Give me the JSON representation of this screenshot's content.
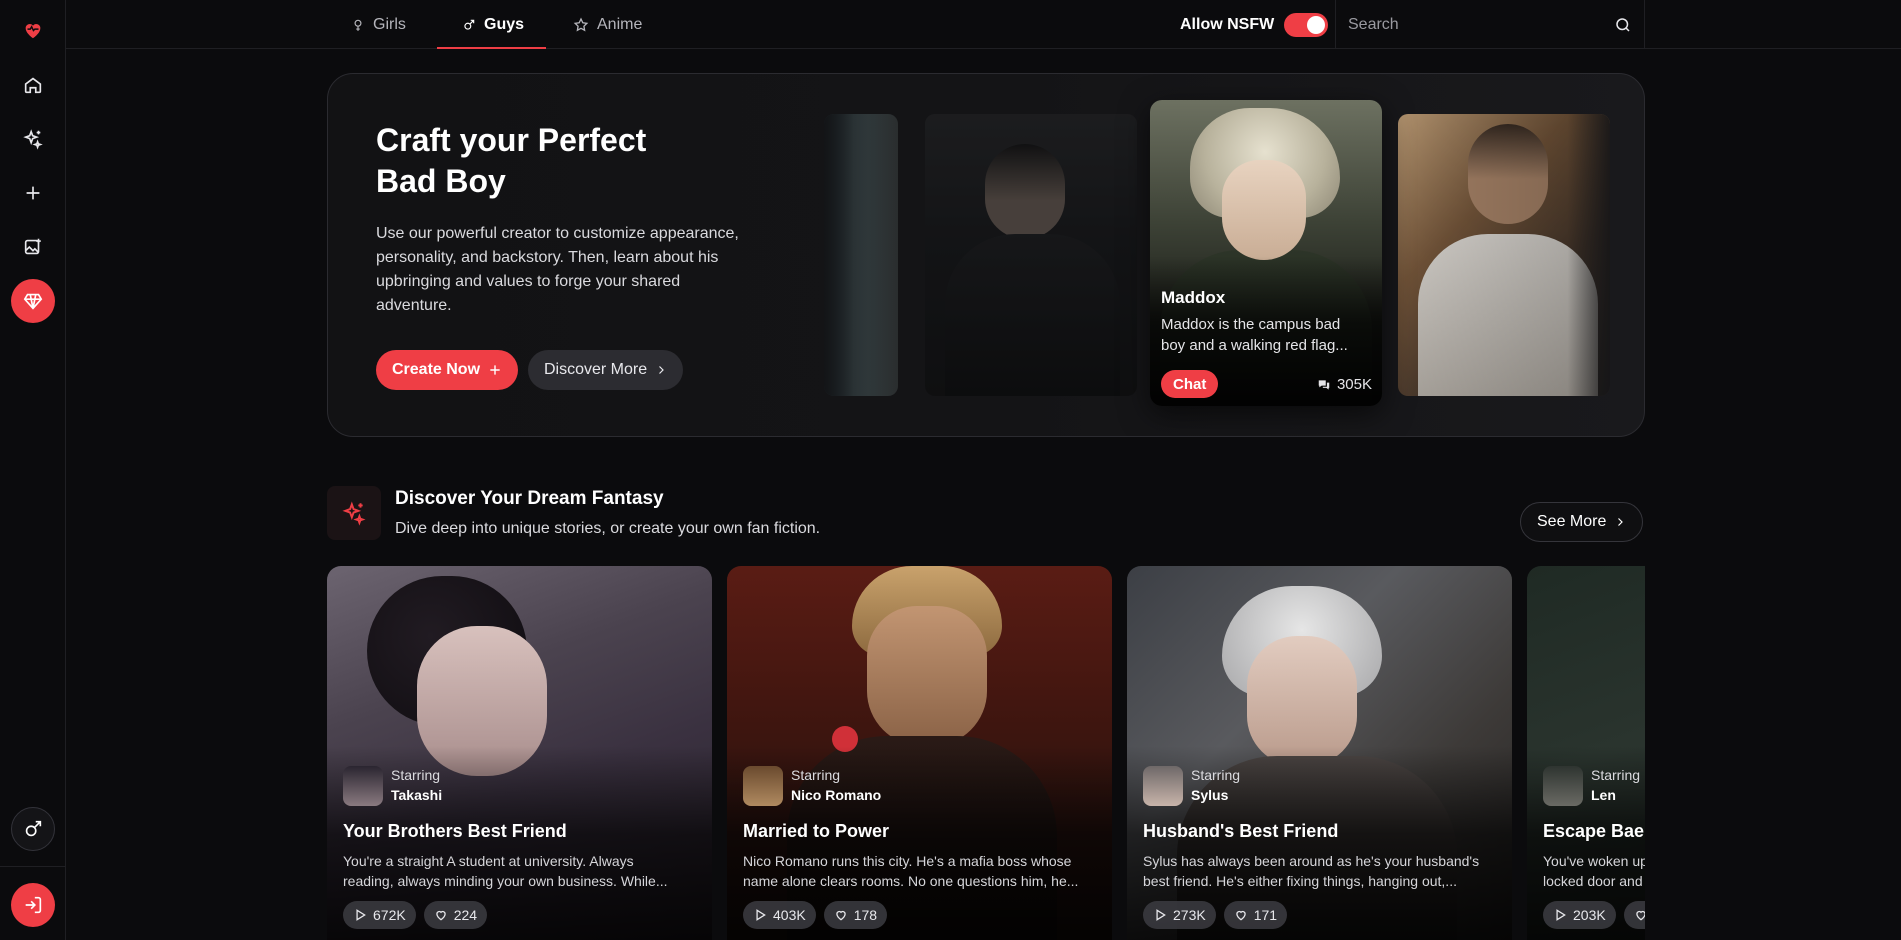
{
  "nav": {
    "tabs": [
      {
        "label": "Girls",
        "icon": "female-icon"
      },
      {
        "label": "Guys",
        "icon": "male-icon",
        "active": true
      },
      {
        "label": "Anime",
        "icon": "star-icon"
      }
    ],
    "nsfw_label": "Allow NSFW",
    "nsfw_enabled": true,
    "search_placeholder": "Search"
  },
  "sidebar": {
    "items": [
      "logo-heart-icon",
      "home-icon",
      "sparkles-icon",
      "plus-icon",
      "image-edit-icon",
      "premium-diamond-icon",
      "gender-male-icon",
      "login-icon"
    ]
  },
  "hero": {
    "title_line1": "Craft your Perfect",
    "title_line2": "Bad Boy",
    "desc_lines": [
      "Use our powerful creator to customize appearance,",
      "personality, and backstory. Then, learn about his",
      "upbringing and values to forge your shared",
      "adventure."
    ],
    "create_label": "Create Now",
    "discover_label": "Discover More",
    "featured": {
      "name": "Maddox",
      "desc_lines": [
        "Maddox is the campus bad",
        "boy and a walking red flag..."
      ],
      "chat_label": "Chat",
      "count": "305K"
    }
  },
  "section": {
    "title": "Discover Your Dream Fantasy",
    "subtitle": "Dive deep into unique stories, or create your own fan fiction.",
    "see_more": "See More"
  },
  "stories": [
    {
      "starring_label": "Starring",
      "star": "Takashi",
      "title": "Your Brothers Best Friend",
      "desc_lines": [
        "You're a straight A student at university. Always",
        "reading, always minding your own business. While..."
      ],
      "plays": "672K",
      "likes": "224"
    },
    {
      "starring_label": "Starring",
      "star": "Nico Romano",
      "title": "Married to Power",
      "desc_lines": [
        "Nico Romano runs this city. He's a mafia boss whose",
        "name alone clears rooms. No one questions him, he..."
      ],
      "plays": "403K",
      "likes": "178"
    },
    {
      "starring_label": "Starring",
      "star": "Sylus",
      "title": "Husband's Best Friend",
      "desc_lines": [
        "Sylus has always been around as he's your husband's",
        "best friend. He's either fixing things, hanging out,..."
      ],
      "plays": "273K",
      "likes": "171"
    },
    {
      "starring_label": "Starring",
      "star": "Len",
      "title": "Escape Bae",
      "desc_lines": [
        "You've woken up",
        "locked door and"
      ],
      "plays": "203K",
      "likes": ""
    }
  ],
  "colors": {
    "accent": "#ef3e45",
    "background": "#0b0b0d"
  }
}
